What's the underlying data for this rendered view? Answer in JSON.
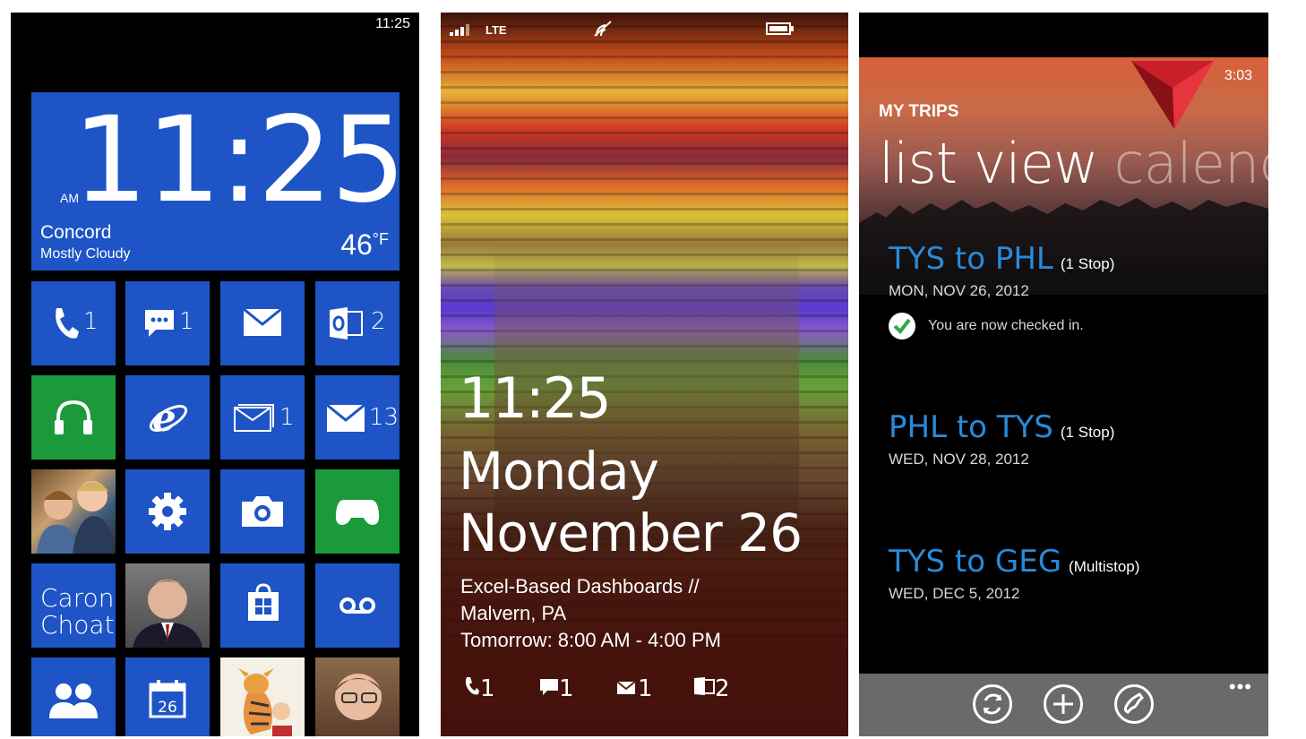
{
  "phone1": {
    "status_time": "11:25",
    "clock": {
      "time": "11:25",
      "ampm": "AM",
      "city": "Concord",
      "condition": "Mostly Cloudy",
      "temp": "46",
      "unit": "°F"
    },
    "tiles": {
      "phone_count": "1",
      "messaging_count": "1",
      "outlook_count": "2",
      "mail2_count": "1",
      "mail3_count": "13",
      "contact_name": "Caron Choate",
      "calendar_day": "26"
    },
    "colors": {
      "tile_blue": "#1e54c6",
      "tile_green": "#1a9a3a"
    }
  },
  "phone2": {
    "status": {
      "network": "LTE"
    },
    "time": "11:25",
    "day": "Monday",
    "date": "November 26",
    "event_line1": "Excel-Based Dashboards //",
    "event_line2": "Malvern, PA",
    "event_line3": "Tomorrow: 8:00 AM - 4:00 PM",
    "notifications": {
      "phone": "1",
      "messages": "1",
      "email": "1",
      "outlook": "2"
    }
  },
  "phone3": {
    "status_time": "3:03",
    "section": "MY TRIPS",
    "pivot_active": "list view",
    "pivot_next": "calend",
    "trips": [
      {
        "route": "TYS to PHL",
        "stops": "(1 Stop)",
        "date": "MON, NOV 26, 2012",
        "status": "You are now checked in."
      },
      {
        "route": "PHL to TYS",
        "stops": "(1 Stop)",
        "date": "WED, NOV 28, 2012"
      },
      {
        "route": "TYS to GEG",
        "stops": "(Multistop)",
        "date": "WED, DEC 5, 2012"
      }
    ],
    "more": "•••",
    "colors": {
      "accent": "#2a8ad8",
      "brand_red": "#c8202a"
    }
  }
}
